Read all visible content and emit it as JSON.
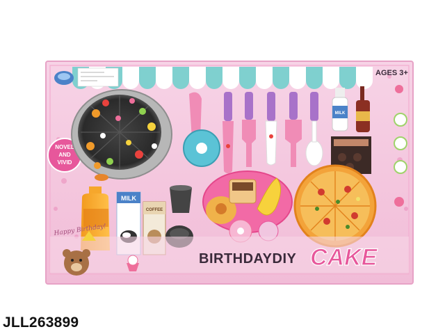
{
  "product": {
    "age_label": "AGES 3+",
    "badge_line1": "NOVEL",
    "badge_line2": "AND",
    "badge_line3": "VIVID",
    "title_part1": "BIRTHDAYDIY",
    "title_part2": "CAKE",
    "script_text": "Happy Birthday!",
    "milk_label": "MILK",
    "milk_bottle_label": "MILK",
    "coffee_label": "COFFEE"
  },
  "sku_code": "JLL263899",
  "colors": {
    "box_pink": "#f4c9de",
    "box_border": "#ec8fbc",
    "awning_teal": "#7fd0cf",
    "title_pink": "#e7579b",
    "title_dark": "#3a2a3a"
  }
}
